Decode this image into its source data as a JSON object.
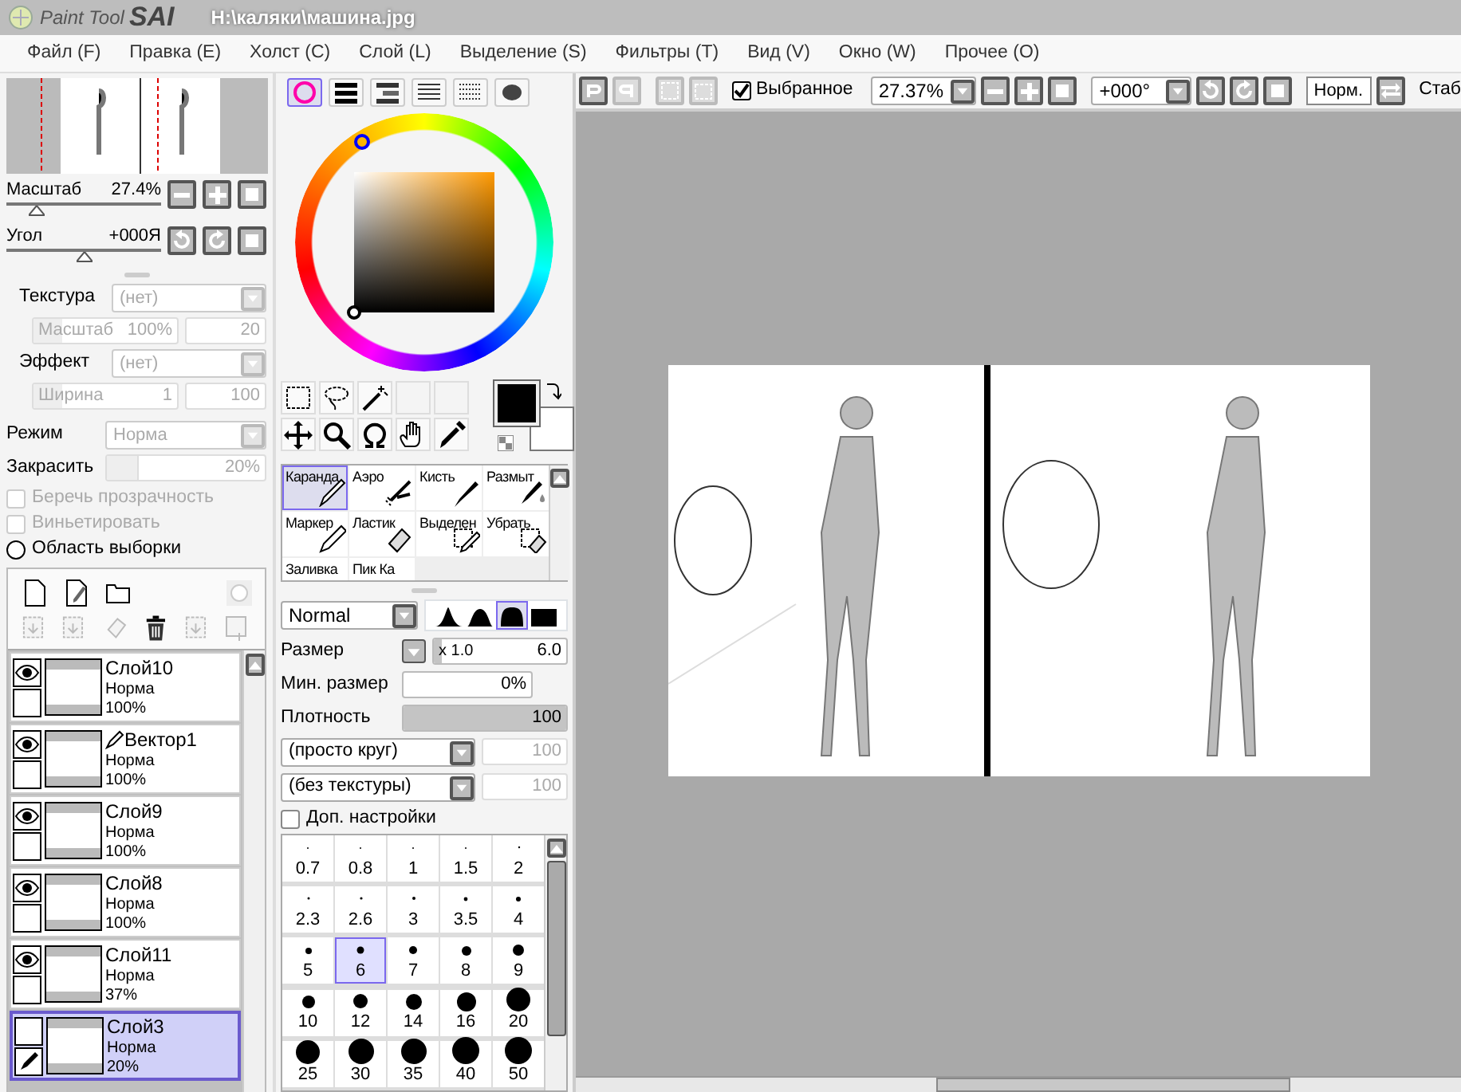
{
  "app_logo": {
    "name": "Paint Tool",
    "brand": "SAI"
  },
  "window": {
    "title": "H:\\каляки\\машина.jpg"
  },
  "menu": [
    "Файл (F)",
    "Правка (E)",
    "Холст (C)",
    "Слой (L)",
    "Выделение (S)",
    "Фильтры (T)",
    "Вид (V)",
    "Окно (W)",
    "Прочее (O)"
  ],
  "navigator": {
    "sliders": [
      {
        "label": "Масштаб",
        "value": "27.4%",
        "level": 0.2
      },
      {
        "label": "Угол",
        "value": "+000Я",
        "level": 0.5
      }
    ]
  },
  "texture": {
    "label": "Текстура",
    "select": "(нет)",
    "scale_label": "Масштаб",
    "scale_value": "100%",
    "strength": "20"
  },
  "effect": {
    "label": "Эффект",
    "select": "(нет)",
    "width_label": "Ширина",
    "width_value": "1",
    "strength": "100"
  },
  "mode": {
    "label": "Режим",
    "select": "Норма"
  },
  "fill": {
    "label": "Закрасить",
    "value": "20%",
    "level": 0.2
  },
  "options": [
    {
      "kind": "checkbox",
      "label": "Беречь прозрачность",
      "checked": false,
      "disabled": true
    },
    {
      "kind": "checkbox",
      "label": "Виньетировать",
      "checked": false,
      "disabled": true
    },
    {
      "kind": "radio",
      "label": "Область выборки",
      "checked": false,
      "disabled": false
    }
  ],
  "layers": [
    {
      "name": "Слой10",
      "mode": "Норма",
      "opacity": "100%",
      "visible": true,
      "vector": false,
      "drawing_target": false,
      "selected": false
    },
    {
      "name": "Вектор1",
      "mode": "Норма",
      "opacity": "100%",
      "visible": true,
      "vector": true,
      "drawing_target": false,
      "selected": false
    },
    {
      "name": "Слой9",
      "mode": "Норма",
      "opacity": "100%",
      "visible": true,
      "vector": false,
      "drawing_target": false,
      "selected": false
    },
    {
      "name": "Слой8",
      "mode": "Норма",
      "opacity": "100%",
      "visible": true,
      "vector": false,
      "drawing_target": false,
      "selected": false
    },
    {
      "name": "Слой11",
      "mode": "Норма",
      "opacity": "37%",
      "visible": true,
      "vector": false,
      "drawing_target": false,
      "selected": false
    },
    {
      "name": "Слой3",
      "mode": "Норма",
      "opacity": "20%",
      "visible": false,
      "vector": false,
      "drawing_target": true,
      "selected": true
    }
  ],
  "color_tabs": [
    {
      "selected": true
    },
    {
      "selected": false
    },
    {
      "selected": false
    },
    {
      "selected": false
    },
    {
      "selected": false
    },
    {
      "selected": false
    }
  ],
  "brush_tools": [
    {
      "label": "Каранда",
      "selected": true
    },
    {
      "label": "Аэро",
      "selected": false
    },
    {
      "label": "Кисть",
      "selected": false
    },
    {
      "label": "Размыт",
      "selected": false
    },
    {
      "label": "Маркер",
      "selected": false
    },
    {
      "label": "Ластик",
      "selected": false
    },
    {
      "label": "Выделен",
      "selected": false
    },
    {
      "label": "Убрать",
      "selected": false
    },
    {
      "label": "Заливка",
      "selected": false
    },
    {
      "label": "Пик Ка",
      "selected": false
    }
  ],
  "blend_mode": "Normal",
  "brush_shapes": [
    {
      "selected": false
    },
    {
      "selected": false
    },
    {
      "selected": true
    },
    {
      "selected": false
    }
  ],
  "size": {
    "label": "Размер",
    "multiplier": "x 1.0",
    "value": "6.0",
    "level": 0.06
  },
  "min_size": {
    "label": "Мин. размер",
    "value": "0%",
    "level": 0
  },
  "density": {
    "label": "Плотность",
    "value": "100",
    "level": 1
  },
  "shape_select": {
    "value": "(просто круг)",
    "strength": "100"
  },
  "texture_select": {
    "value": "(без текстуры)",
    "strength": "100"
  },
  "advanced": {
    "label": "Доп. настройки",
    "checked": false
  },
  "brush_sizes": [
    {
      "label": "0.7",
      "selected": false
    },
    {
      "label": "0.8",
      "selected": false
    },
    {
      "label": "1",
      "selected": false
    },
    {
      "label": "1.5",
      "selected": false
    },
    {
      "label": "2",
      "selected": false
    },
    {
      "label": "2.3",
      "selected": false
    },
    {
      "label": "2.6",
      "selected": false
    },
    {
      "label": "3",
      "selected": false
    },
    {
      "label": "3.5",
      "selected": false
    },
    {
      "label": "4",
      "selected": false
    },
    {
      "label": "5",
      "selected": false
    },
    {
      "label": "6",
      "selected": true
    },
    {
      "label": "7",
      "selected": false
    },
    {
      "label": "8",
      "selected": false
    },
    {
      "label": "9",
      "selected": false
    },
    {
      "label": "10",
      "selected": false
    },
    {
      "label": "12",
      "selected": false
    },
    {
      "label": "14",
      "selected": false
    },
    {
      "label": "16",
      "selected": false
    },
    {
      "label": "20",
      "selected": false
    },
    {
      "label": "25",
      "selected": false
    },
    {
      "label": "30",
      "selected": false
    },
    {
      "label": "35",
      "selected": false
    },
    {
      "label": "40",
      "selected": false
    },
    {
      "label": "50",
      "selected": false
    }
  ],
  "canvas_toolbar": {
    "selection_only": {
      "label": "Выбранное",
      "checked": true
    },
    "zoom": "27.37%",
    "angle": "+000°",
    "reset_button": "Норм.",
    "stabilizer_label": "Стаб"
  }
}
